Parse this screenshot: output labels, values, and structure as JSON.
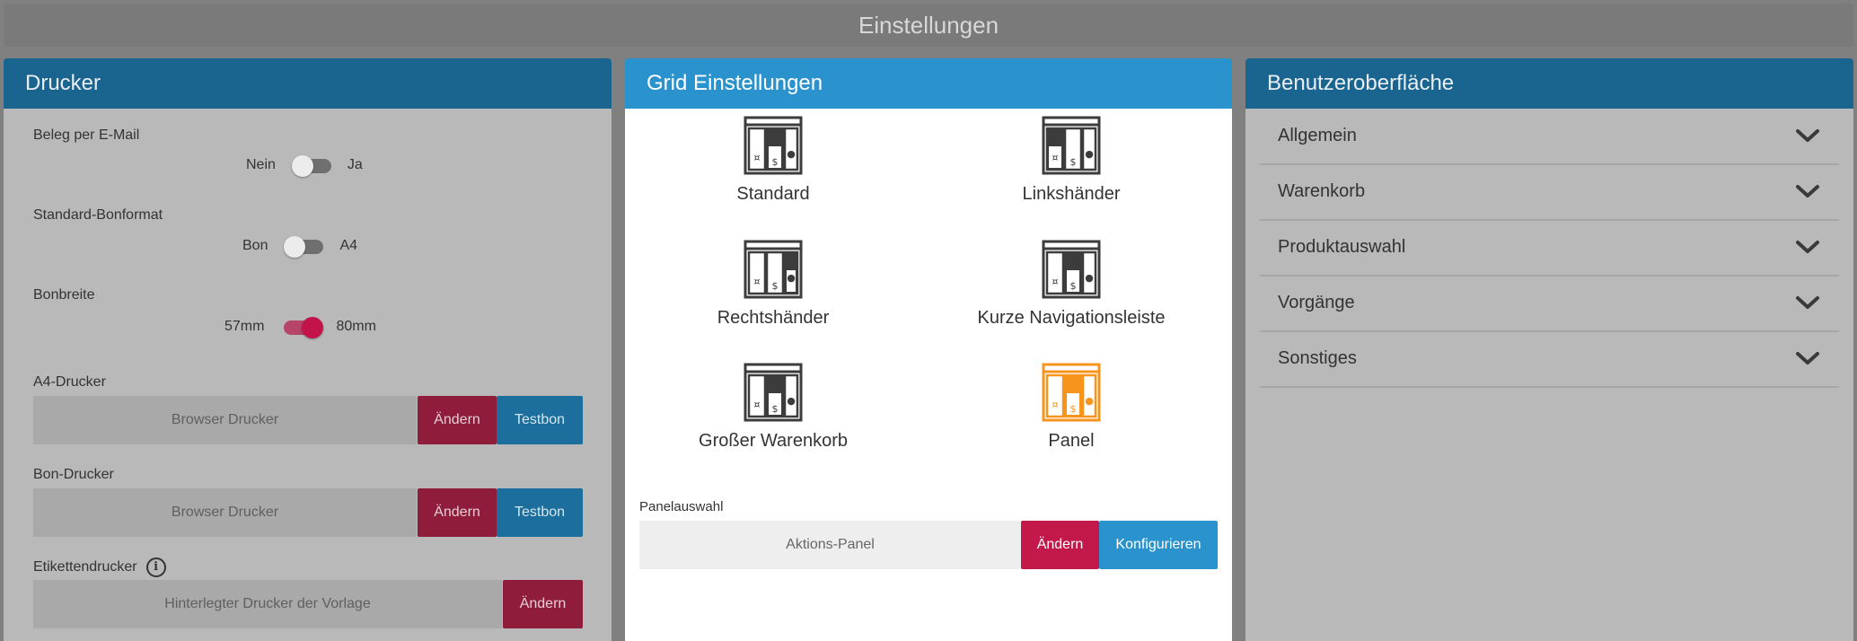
{
  "title": "Einstellungen",
  "drucker": {
    "header": "Drucker",
    "beleg_email": {
      "label": "Beleg per E-Mail",
      "off": "Nein",
      "on": "Ja",
      "value": false
    },
    "bonformat": {
      "label": "Standard-Bonformat",
      "off": "Bon",
      "on": "A4",
      "value": false
    },
    "bonbreite": {
      "label": "Bonbreite",
      "off": "57mm",
      "on": "80mm",
      "value": true
    },
    "a4": {
      "label": "A4-Drucker",
      "value": "Browser Drucker",
      "change": "Ändern",
      "test": "Testbon"
    },
    "bon": {
      "label": "Bon-Drucker",
      "value": "Browser Drucker",
      "change": "Ändern",
      "test": "Testbon"
    },
    "etikett": {
      "label": "Etikettendrucker",
      "info": "i",
      "value": "Hinterlegter Drucker der Vorlage",
      "change": "Ändern"
    }
  },
  "grid": {
    "header": "Grid Einstellungen",
    "layouts": [
      {
        "name": "Standard",
        "icon": "layout-standard-icon",
        "selected": false
      },
      {
        "name": "Linkshänder",
        "icon": "layout-linkshaender-icon",
        "selected": false
      },
      {
        "name": "Rechtshänder",
        "icon": "layout-rechtshaender-icon",
        "selected": false
      },
      {
        "name": "Kurze Navigationsleiste",
        "icon": "layout-kurze-navigationsleiste-icon",
        "selected": false
      },
      {
        "name": "Großer Warenkorb",
        "icon": "layout-grosser-warenkorb-icon",
        "selected": false
      },
      {
        "name": "Panel",
        "icon": "layout-panel-icon",
        "selected": true
      }
    ],
    "panel": {
      "label": "Panelauswahl",
      "value": "Aktions-Panel",
      "change": "Ändern",
      "configure": "Konfigurieren"
    }
  },
  "ui": {
    "header": "Benutzeroberfläche",
    "items": [
      "Allgemein",
      "Warenkorb",
      "Produktauswahl",
      "Vorgänge",
      "Sonstiges"
    ]
  },
  "colors": {
    "accent_blue": "#2a92cc",
    "accent_red": "#c2184a",
    "selected_orange": "#f7941d",
    "icon_dark": "#3c3c3c"
  }
}
